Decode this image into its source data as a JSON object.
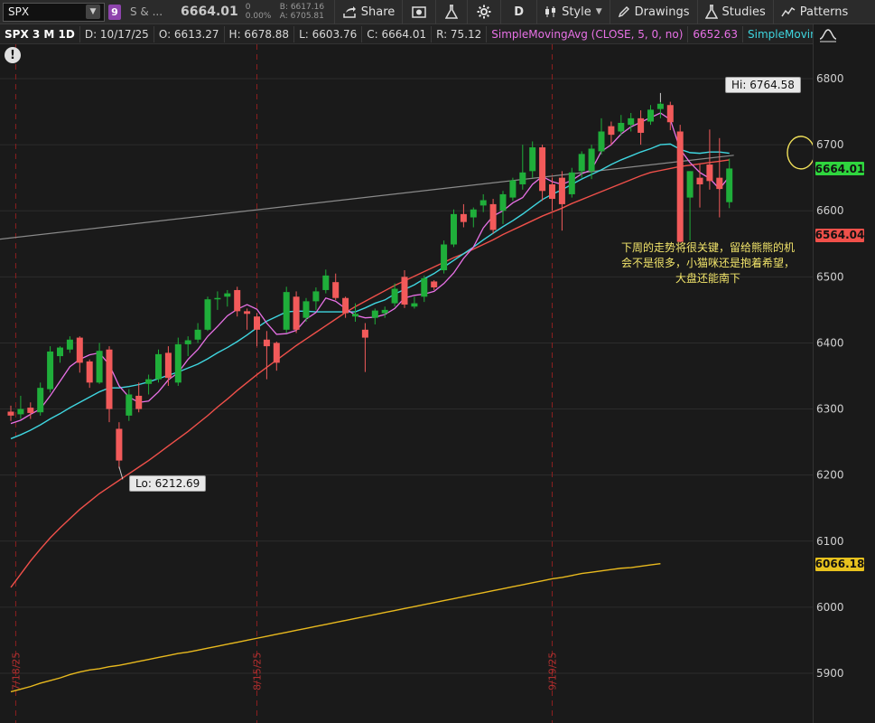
{
  "toolbar": {
    "symbol": "SPX",
    "link_badge": "9",
    "description": "S & ...",
    "last_price": "6664.01",
    "change_line1": "0",
    "change_line2": "0.00%",
    "bid": "B: 6617.16",
    "ask": "A: 6705.81",
    "share_label": "Share",
    "aggregation_label": "D",
    "style_label": "Style",
    "drawings_label": "Drawings",
    "studies_label": "Studies",
    "patterns_label": "Patterns"
  },
  "infobar": {
    "title": "SPX 3 M 1D",
    "date": "D: 10/17/25",
    "open": "O: 6613.27",
    "high": "H: 6678.88",
    "low": "L: 6603.76",
    "close": "C: 6664.01",
    "range": "R: 75.12",
    "study1": "SimpleMovingAvg (CLOSE, 5, 0, no)",
    "study1_value": "6652.63",
    "study2": "SimpleMovingAvg ..."
  },
  "price_tags": {
    "last": "6664.01",
    "ma_mid": "6564.04",
    "ma_long": "6066.18"
  },
  "colors": {
    "up": "#1fae3a",
    "down": "#f25a5a",
    "sma5": "#e871e6",
    "sma_cyan": "#3fd6e0",
    "sma_red": "#f0504a",
    "sma_gold": "#e8b91e",
    "annotation": "#f2e46a"
  },
  "callouts": {
    "high": "Hi: 6764.58",
    "low": "Lo: 6212.69"
  },
  "annotation_lines": [
    "下周的走势将很关键，留给熊熊的机",
    "会不是很多，小猫咪还是抱着希望，",
    "大盘还能南下"
  ],
  "chart_data": {
    "type": "candlestick",
    "y_ticks": [
      5900,
      6000,
      6100,
      6200,
      6300,
      6400,
      6500,
      6600,
      6700,
      6800
    ],
    "ylim": [
      5865,
      6830
    ],
    "x_markers": [
      "7/18/25",
      "8/15/25",
      "9/19/25"
    ],
    "candles": [
      [
        6296,
        6305,
        6282,
        6290
      ],
      [
        6292,
        6320,
        6285,
        6300
      ],
      [
        6302,
        6310,
        6285,
        6294
      ],
      [
        6295,
        6340,
        6290,
        6332
      ],
      [
        6330,
        6395,
        6325,
        6387
      ],
      [
        6380,
        6395,
        6370,
        6393
      ],
      [
        6390,
        6410,
        6385,
        6405
      ],
      [
        6408,
        6410,
        6355,
        6370
      ],
      [
        6372,
        6375,
        6332,
        6340
      ],
      [
        6340,
        6400,
        6338,
        6388
      ],
      [
        6390,
        6395,
        6280,
        6300
      ],
      [
        6270,
        6280,
        6210,
        6222
      ],
      [
        6290,
        6330,
        6282,
        6322
      ],
      [
        6320,
        6340,
        6295,
        6300
      ],
      [
        6338,
        6352,
        6322,
        6345
      ],
      [
        6345,
        6390,
        6340,
        6383
      ],
      [
        6385,
        6395,
        6335,
        6347
      ],
      [
        6340,
        6408,
        6335,
        6398
      ],
      [
        6398,
        6410,
        6380,
        6404
      ],
      [
        6405,
        6430,
        6400,
        6420
      ],
      [
        6420,
        6470,
        6418,
        6466
      ],
      [
        6466,
        6478,
        6450,
        6468
      ],
      [
        6470,
        6480,
        6455,
        6475
      ],
      [
        6480,
        6485,
        6440,
        6448
      ],
      [
        6448,
        6452,
        6420,
        6444
      ],
      [
        6440,
        6445,
        6395,
        6420
      ],
      [
        6405,
        6418,
        6345,
        6395
      ],
      [
        6400,
        6402,
        6358,
        6370
      ],
      [
        6420,
        6485,
        6415,
        6477
      ],
      [
        6470,
        6478,
        6415,
        6420
      ],
      [
        6438,
        6468,
        6432,
        6463
      ],
      [
        6463,
        6484,
        6450,
        6478
      ],
      [
        6480,
        6511,
        6475,
        6502
      ],
      [
        6492,
        6505,
        6465,
        6468
      ],
      [
        6468,
        6470,
        6438,
        6445
      ],
      [
        6440,
        6460,
        6432,
        6444
      ],
      [
        6420,
        6430,
        6356,
        6408
      ],
      [
        6438,
        6452,
        6428,
        6449
      ],
      [
        6445,
        6455,
        6438,
        6450
      ],
      [
        6460,
        6490,
        6455,
        6482
      ],
      [
        6500,
        6510,
        6453,
        6458
      ],
      [
        6455,
        6470,
        6452,
        6460
      ],
      [
        6470,
        6502,
        6462,
        6498
      ],
      [
        6493,
        6495,
        6480,
        6484
      ],
      [
        6510,
        6555,
        6505,
        6549
      ],
      [
        6549,
        6602,
        6545,
        6595
      ],
      [
        6595,
        6610,
        6575,
        6583
      ],
      [
        6590,
        6605,
        6575,
        6602
      ],
      [
        6608,
        6625,
        6598,
        6616
      ],
      [
        6610,
        6618,
        6565,
        6571
      ],
      [
        6600,
        6630,
        6580,
        6625
      ],
      [
        6620,
        6650,
        6615,
        6646
      ],
      [
        6640,
        6700,
        6632,
        6658
      ],
      [
        6660,
        6705,
        6650,
        6696
      ],
      [
        6696,
        6700,
        6615,
        6630
      ],
      [
        6640,
        6650,
        6600,
        6618
      ],
      [
        6650,
        6660,
        6570,
        6610
      ],
      [
        6625,
        6665,
        6620,
        6658
      ],
      [
        6660,
        6690,
        6650,
        6686
      ],
      [
        6660,
        6700,
        6648,
        6694
      ],
      [
        6690,
        6740,
        6685,
        6720
      ],
      [
        6728,
        6735,
        6700,
        6715
      ],
      [
        6720,
        6745,
        6714,
        6733
      ],
      [
        6730,
        6748,
        6720,
        6740
      ],
      [
        6740,
        6752,
        6700,
        6718
      ],
      [
        6735,
        6760,
        6730,
        6753
      ],
      [
        6754,
        6765,
        6740,
        6762
      ],
      [
        6760,
        6765,
        6722,
        6734
      ],
      [
        6720,
        6730,
        6552,
        6553
      ],
      [
        6620,
        6660,
        6555,
        6660
      ],
      [
        6650,
        6670,
        6605,
        6640
      ],
      [
        6670,
        6723,
        6632,
        6645
      ],
      [
        6650,
        6710,
        6590,
        6633
      ],
      [
        6613,
        6679,
        6604,
        6664
      ]
    ],
    "sma5": [
      6278,
      6283,
      6292,
      6300,
      6320,
      6342,
      6364,
      6375,
      6382,
      6385,
      6367,
      6335,
      6318,
      6310,
      6312,
      6326,
      6344,
      6355,
      6375,
      6390,
      6410,
      6425,
      6441,
      6451,
      6458,
      6451,
      6430,
      6413,
      6414,
      6419,
      6436,
      6446,
      6468,
      6463,
      6452,
      6442,
      6438,
      6439,
      6443,
      6452,
      6468,
      6472,
      6474,
      6478,
      6490,
      6506,
      6528,
      6545,
      6574,
      6592,
      6600,
      6612,
      6620,
      6640,
      6652,
      6644,
      6640,
      6646,
      6656,
      6662,
      6690,
      6700,
      6716,
      6727,
      6734,
      6741,
      6748,
      6738,
      6693,
      6673,
      6658,
      6649,
      6633,
      6652
    ],
    "sma_cyan": [
      6255,
      6261,
      6268,
      6276,
      6285,
      6293,
      6302,
      6310,
      6318,
      6326,
      6332,
      6332,
      6334,
      6337,
      6341,
      6346,
      6351,
      6356,
      6362,
      6368,
      6376,
      6385,
      6393,
      6402,
      6412,
      6423,
      6433,
      6440,
      6447,
      6448,
      6448,
      6447,
      6447,
      6447,
      6447,
      6447,
      6453,
      6460,
      6465,
      6474,
      6481,
      6488,
      6497,
      6505,
      6515,
      6525,
      6535,
      6545,
      6556,
      6566,
      6576,
      6585,
      6595,
      6606,
      6617,
      6625,
      6632,
      6640,
      6648,
      6655,
      6662,
      6670,
      6677,
      6683,
      6689,
      6694,
      6700,
      6701,
      6693,
      6688,
      6687,
      6689,
      6689,
      6687
    ],
    "sma_red": [
      6030,
      6050,
      6070,
      6088,
      6105,
      6120,
      6134,
      6148,
      6160,
      6172,
      6182,
      6192,
      6202,
      6212,
      6222,
      6233,
      6244,
      6255,
      6266,
      6278,
      6290,
      6303,
      6315,
      6328,
      6340,
      6352,
      6363,
      6374,
      6385,
      6396,
      6406,
      6416,
      6426,
      6436,
      6446,
      6455,
      6463,
      6471,
      6479,
      6487,
      6494,
      6501,
      6508,
      6515,
      6522,
      6529,
      6535,
      6542,
      6549,
      6556,
      6564,
      6571,
      6578,
      6585,
      6592,
      6598,
      6604,
      6611,
      6617,
      6623,
      6629,
      6635,
      6641,
      6647,
      6653,
      6658,
      6661,
      6664,
      6667,
      6669,
      6671,
      6673,
      6675,
      6677
    ],
    "sma_gold": [
      5872,
      5876,
      5880,
      5885,
      5889,
      5893,
      5898,
      5902,
      5905,
      5907,
      5910,
      5912,
      5915,
      5918,
      5921,
      5924,
      5927,
      5930,
      5932,
      5935,
      5938,
      5941,
      5944,
      5947,
      5950,
      5953,
      5956,
      5959,
      5962,
      5965,
      5968,
      5971,
      5974,
      5977,
      5980,
      5983,
      5986,
      5989,
      5992,
      5995,
      5998,
      6001,
      6004,
      6007,
      6010,
      6013,
      6016,
      6019,
      6022,
      6025,
      6028,
      6031,
      6034,
      6037,
      6040,
      6043,
      6045,
      6048,
      6051,
      6053,
      6055,
      6057,
      6059,
      6060,
      6062,
      6064,
      6066
    ],
    "trendline": {
      "from": {
        "index": 0,
        "price": 6557
      },
      "to": {
        "index": 73,
        "price": 6684
      }
    }
  }
}
